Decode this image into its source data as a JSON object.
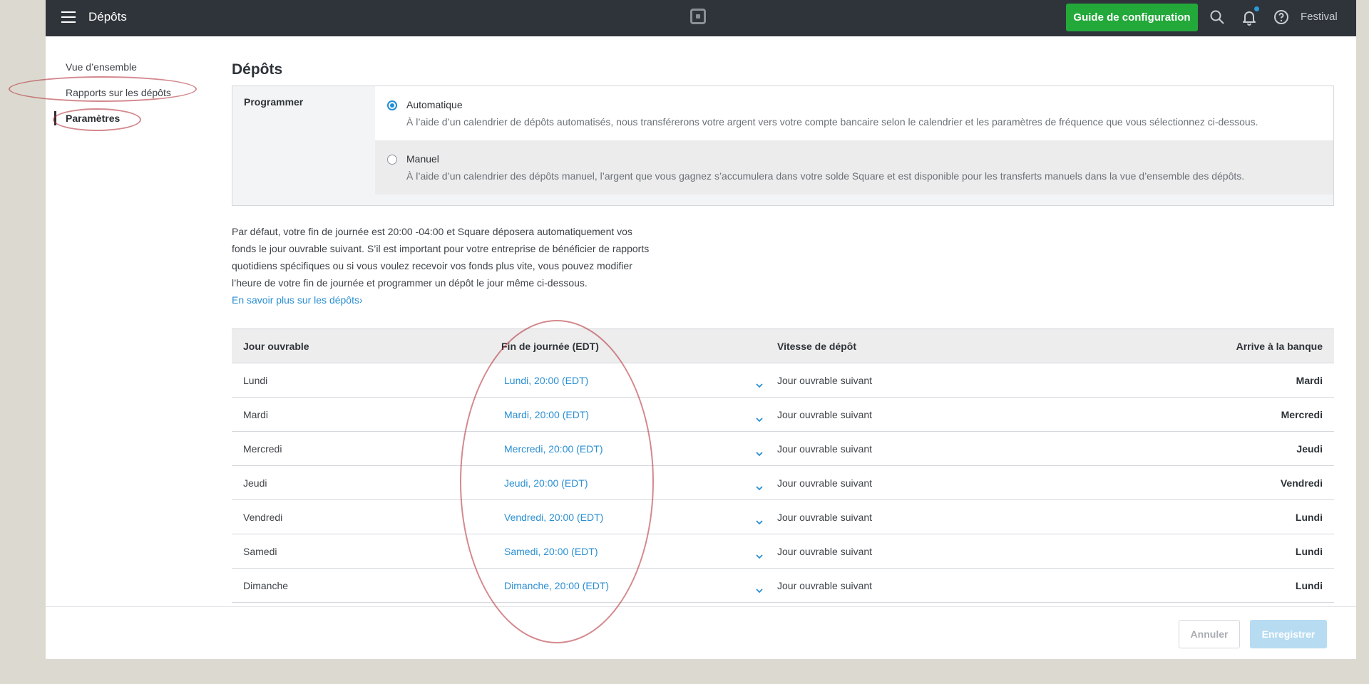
{
  "topbar": {
    "title": "Dépôts",
    "setup_button": "Guide de configuration",
    "account_name": "Festival",
    "icons": [
      "menu-icon",
      "square-logo-icon",
      "search-icon",
      "bell-icon",
      "help-icon"
    ]
  },
  "sidebar": {
    "items": [
      {
        "label": "Vue d’ensemble",
        "active": false
      },
      {
        "label": "Rapports sur les dépôts",
        "active": false
      },
      {
        "label": "Paramètres",
        "active": true
      }
    ]
  },
  "main": {
    "title": "Dépôts",
    "schedule": {
      "label": "Programmer",
      "options": [
        {
          "title": "Automatique",
          "selected": true,
          "description": "À l’aide d’un calendrier de dépôts automatisés, nous transférerons votre argent vers votre compte bancaire selon le calendrier et les paramètres de fréquence que vous sélectionnez ci-dessous."
        },
        {
          "title": "Manuel",
          "selected": false,
          "description": "À l’aide d’un calendrier des dépôts manuel, l’argent que vous gagnez s’accumulera dans votre solde Square et est disponible pour les transferts manuels dans la vue d’ensemble des dépôts."
        }
      ]
    },
    "intro_text": "Par défaut, votre fin de journée est 20:00 -04:00 et Square déposera automatiquement vos fonds le jour ouvrable suivant. S’il est important pour votre entreprise de bénéficier de rapports quotidiens spécifiques ou si vous voulez recevoir vos fonds plus vite, vous pouvez modifier l’heure de votre fin de journée et programmer un dépôt le jour même ci-dessous.",
    "learn_more": "En savoir plus sur les dépôts›",
    "table": {
      "headers": [
        "Jour ouvrable",
        "Fin de journée (EDT)",
        "Vitesse de dépôt",
        "Arrive à la banque"
      ],
      "rows": [
        {
          "day": "Lundi",
          "end": "Lundi, 20:00 (EDT)",
          "speed": "Jour ouvrable suivant",
          "arrives": "Mardi"
        },
        {
          "day": "Mardi",
          "end": "Mardi, 20:00 (EDT)",
          "speed": "Jour ouvrable suivant",
          "arrives": "Mercredi"
        },
        {
          "day": "Mercredi",
          "end": "Mercredi, 20:00 (EDT)",
          "speed": "Jour ouvrable suivant",
          "arrives": "Jeudi"
        },
        {
          "day": "Jeudi",
          "end": "Jeudi, 20:00 (EDT)",
          "speed": "Jour ouvrable suivant",
          "arrives": "Vendredi"
        },
        {
          "day": "Vendredi",
          "end": "Vendredi, 20:00 (EDT)",
          "speed": "Jour ouvrable suivant",
          "arrives": "Lundi"
        },
        {
          "day": "Samedi",
          "end": "Samedi, 20:00 (EDT)",
          "speed": "Jour ouvrable suivant",
          "arrives": "Lundi"
        },
        {
          "day": "Dimanche",
          "end": "Dimanche, 20:00 (EDT)",
          "speed": "Jour ouvrable suivant",
          "arrives": "Lundi"
        }
      ]
    }
  },
  "footer": {
    "cancel": "Annuler",
    "save": "Enregistrer"
  },
  "colors": {
    "topbar": "#2f343a",
    "setup_button": "#23a83a",
    "link": "#2a8fd3",
    "save_disabled": "#b7dcf2",
    "annotation": "#b02832"
  }
}
